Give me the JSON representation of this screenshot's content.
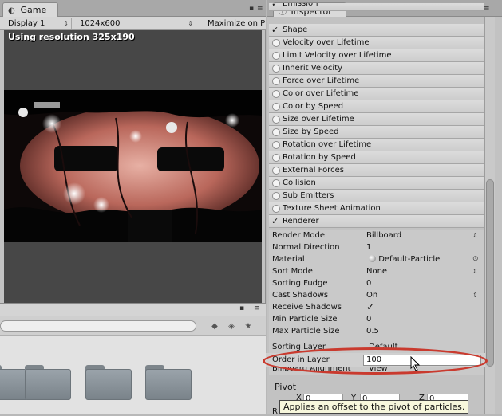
{
  "game_panel": {
    "tab_label": "Game",
    "toolbar": {
      "display": "Display 1",
      "resolution": "1024x600",
      "maximize": "Maximize on P"
    },
    "overlay_text": "Using resolution 325x190"
  },
  "inspector": {
    "tab_label": "Inspector",
    "modules": [
      {
        "label": "Emission",
        "state": "checked",
        "partial": true
      },
      {
        "label": "Shape",
        "state": "checked"
      },
      {
        "label": "Velocity over Lifetime",
        "state": "off"
      },
      {
        "label": "Limit Velocity over Lifetime",
        "state": "off"
      },
      {
        "label": "Inherit Velocity",
        "state": "off"
      },
      {
        "label": "Force over Lifetime",
        "state": "off"
      },
      {
        "label": "Color over Lifetime",
        "state": "off"
      },
      {
        "label": "Color by Speed",
        "state": "off"
      },
      {
        "label": "Size over Lifetime",
        "state": "off"
      },
      {
        "label": "Size by Speed",
        "state": "off"
      },
      {
        "label": "Rotation over Lifetime",
        "state": "off"
      },
      {
        "label": "Rotation by Speed",
        "state": "off"
      },
      {
        "label": "External Forces",
        "state": "off"
      },
      {
        "label": "Collision",
        "state": "off"
      },
      {
        "label": "Sub Emitters",
        "state": "off"
      },
      {
        "label": "Texture Sheet Animation",
        "state": "off"
      },
      {
        "label": "Renderer",
        "state": "checked"
      }
    ],
    "renderer": {
      "render_mode": {
        "label": "Render Mode",
        "value": "Billboard"
      },
      "normal_direction": {
        "label": "Normal Direction",
        "value": "1"
      },
      "material": {
        "label": "Material",
        "value": "Default-Particle"
      },
      "sort_mode": {
        "label": "Sort Mode",
        "value": "None"
      },
      "sorting_fudge": {
        "label": "Sorting Fudge",
        "value": "0"
      },
      "cast_shadows": {
        "label": "Cast Shadows",
        "value": "On"
      },
      "receive_shadows": {
        "label": "Receive Shadows",
        "checked": true
      },
      "min_particle_size": {
        "label": "Min Particle Size",
        "value": "0"
      },
      "max_particle_size": {
        "label": "Max Particle Size",
        "value": "0.5"
      },
      "sorting_layer": {
        "label": "Sorting Layer",
        "value": "Default"
      },
      "order_in_layer": {
        "label": "Order in Layer",
        "value": "100"
      },
      "billboard_alignment": {
        "label": "Billboard Alignment",
        "value": "View"
      }
    },
    "pivot": {
      "label": "Pivot",
      "x_label": "X",
      "x_value": "0",
      "y_label": "Y",
      "y_value": "0",
      "z_label": "Z",
      "z_value": "0",
      "next_label": "R"
    },
    "tooltip": "Applies an offset to the pivot of particles."
  },
  "colors": {
    "highlight": "#c93a2e",
    "game_background": "#474747",
    "panel_background": "#c2c2c2"
  }
}
